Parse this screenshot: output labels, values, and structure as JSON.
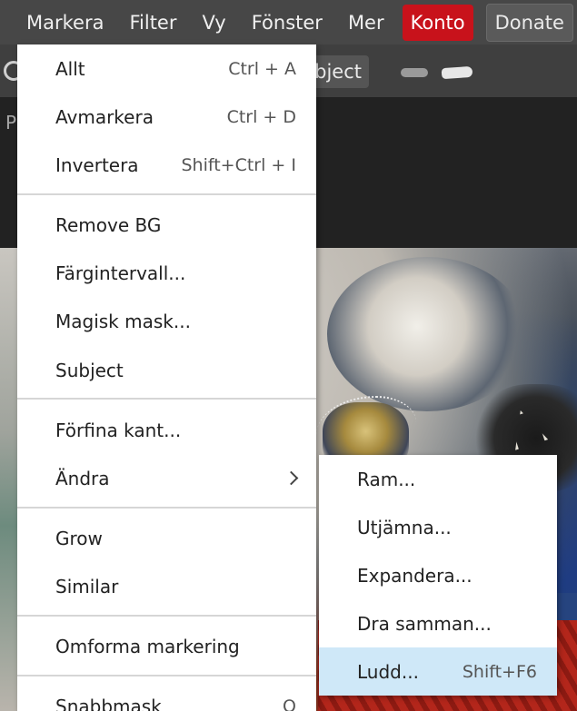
{
  "menubar": {
    "items": [
      "Markera",
      "Filter",
      "Vy",
      "Fönster",
      "Mer"
    ],
    "account": "Konto",
    "donate": "Donate",
    "colors": {
      "bar": "#474747",
      "account_bg": "#c8121b"
    }
  },
  "toolbar": {
    "subject_button": "Subject",
    "icons": [
      "refresh-icon",
      "brush-size-small-icon",
      "brush-size-large-icon"
    ]
  },
  "panel": {
    "label": "P"
  },
  "select_menu": {
    "items": [
      {
        "label": "Allt",
        "shortcut": "Ctrl + A"
      },
      {
        "label": "Avmarkera",
        "shortcut": "Ctrl + D"
      },
      {
        "label": "Invertera",
        "shortcut": "Shift+Ctrl + I"
      },
      {
        "label": "Remove BG",
        "shortcut": ""
      },
      {
        "label": "Färgintervall...",
        "shortcut": ""
      },
      {
        "label": "Magisk mask...",
        "shortcut": ""
      },
      {
        "label": "Subject",
        "shortcut": ""
      },
      {
        "label": "Förfina kant...",
        "shortcut": ""
      },
      {
        "label": "Ändra",
        "shortcut": "",
        "submenu": true
      },
      {
        "label": "Grow",
        "shortcut": ""
      },
      {
        "label": "Similar",
        "shortcut": ""
      },
      {
        "label": "Omforma markering",
        "shortcut": ""
      },
      {
        "label": "Snabbmask",
        "shortcut": "Q"
      }
    ]
  },
  "modify_submenu": {
    "items": [
      {
        "label": "Ram...",
        "shortcut": ""
      },
      {
        "label": "Utjämna...",
        "shortcut": ""
      },
      {
        "label": "Expandera...",
        "shortcut": ""
      },
      {
        "label": "Dra samman...",
        "shortcut": ""
      },
      {
        "label": "Ludd...",
        "shortcut": "Shift+F6",
        "highlighted": true
      }
    ],
    "highlight_color": "#cfe8f8"
  }
}
